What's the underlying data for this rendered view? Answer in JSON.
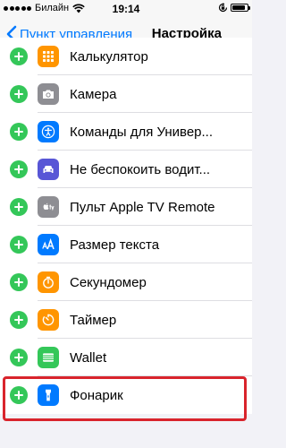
{
  "status_bar": {
    "carrier": "Билайн",
    "time": "19:14",
    "battery_level": 0.9
  },
  "nav": {
    "back_label": "Пункт управления",
    "title": "Настройка"
  },
  "items": [
    {
      "label": "Калькулятор",
      "icon": "calculator-icon",
      "color": "#ff9500"
    },
    {
      "label": "Камера",
      "icon": "camera-icon",
      "color": "#8e8e93"
    },
    {
      "label": "Команды для Универ...",
      "icon": "accessibility-icon",
      "color": "#007aff"
    },
    {
      "label": "Не беспокоить водит...",
      "icon": "car-icon",
      "color": "#5856d6"
    },
    {
      "label": "Пульт Apple TV Remote",
      "icon": "apple-tv-icon",
      "color": "#8e8e93"
    },
    {
      "label": "Размер текста",
      "icon": "text-size-icon",
      "color": "#007aff"
    },
    {
      "label": "Секундомер",
      "icon": "stopwatch-icon",
      "color": "#ff9500"
    },
    {
      "label": "Таймер",
      "icon": "timer-icon",
      "color": "#ff9500"
    },
    {
      "label": "Wallet",
      "icon": "wallet-icon",
      "color": "#34c759"
    },
    {
      "label": "Фонарик",
      "icon": "flashlight-icon",
      "color": "#007aff"
    }
  ],
  "highlight_color": "#d9242c"
}
